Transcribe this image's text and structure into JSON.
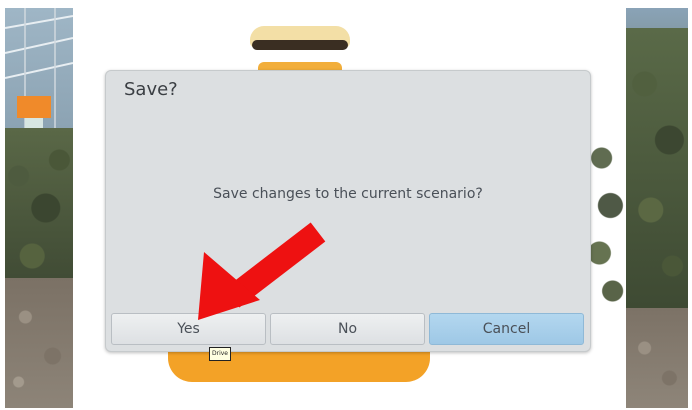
{
  "dialog": {
    "title": "Save?",
    "message": "Save changes to the current scenario?",
    "buttons": {
      "yes": "Yes",
      "no": "No",
      "cancel": "Cancel"
    }
  },
  "tooltip": {
    "text": "Drive"
  },
  "annotation": {
    "arrow_color": "#ee1111",
    "points_to": "yes-button"
  },
  "colors": {
    "dialog_bg": "#dcdfe1",
    "cancel_highlight": "#a8cfea",
    "accent_orange": "#f3a227"
  }
}
